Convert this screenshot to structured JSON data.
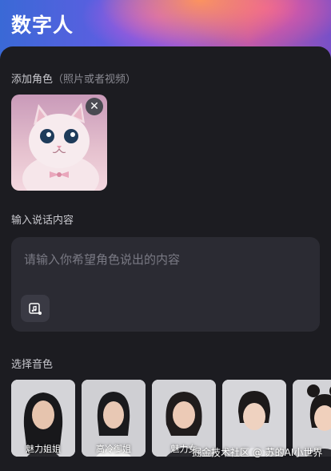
{
  "header": {
    "title": "数字人"
  },
  "add_role": {
    "label": "添加角色",
    "hint": "（照片或者视频）"
  },
  "speech": {
    "label": "输入说话内容",
    "placeholder": "请输入你希望角色说出的内容"
  },
  "voice": {
    "label": "选择音色",
    "options": [
      {
        "name": "魅力姐姐"
      },
      {
        "name": "高冷御姐"
      },
      {
        "name": "魅力女"
      },
      {
        "name": ""
      },
      {
        "name": ""
      }
    ]
  },
  "watermark": "掘金技术社区 @ 苏的AI小世界"
}
